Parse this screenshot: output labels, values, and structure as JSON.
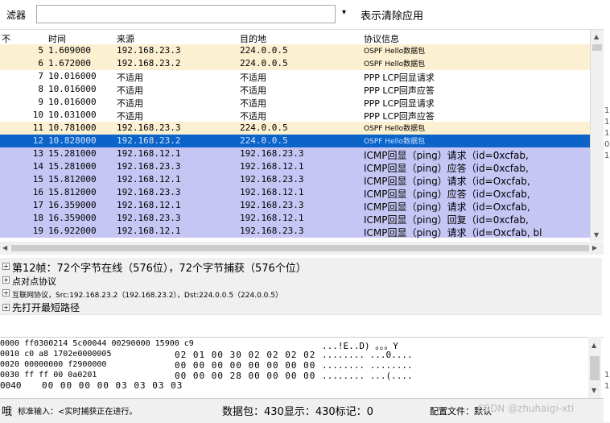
{
  "filter": {
    "label": "滤器",
    "value": "",
    "dropdown": "▾",
    "actions": "表示清除应用"
  },
  "columns": {
    "no": "不",
    "time": "时间",
    "source": "来源",
    "destination": "目的地",
    "info": "协议信息"
  },
  "packets": [
    {
      "no": "5",
      "time": "1.609000",
      "src": "192.168.23.3",
      "dst": "224.0.0.5",
      "info": "OSPF Hello数据包",
      "type": "ospf"
    },
    {
      "no": "6",
      "time": "1.672000",
      "src": "192.168.23.2",
      "dst": "224.0.0.5",
      "info": "OSPF Hello数据包",
      "type": "ospf"
    },
    {
      "no": "7",
      "time": "10.016000",
      "src": "不适用",
      "dst": "不适用",
      "info": "PPP LCP回显请求",
      "type": "ppp"
    },
    {
      "no": "8",
      "time": "10.016000",
      "src": "不适用",
      "dst": "不适用",
      "info": "PPP LCP回声应答",
      "type": "ppp"
    },
    {
      "no": "9",
      "time": "10.016000",
      "src": "不适用",
      "dst": "不适用",
      "info": "PPP LCP回显请求",
      "type": "ppp"
    },
    {
      "no": "10",
      "time": "10.031000",
      "src": "不适用",
      "dst": "不适用",
      "info": "PPP LCP回声应答",
      "type": "ppp"
    },
    {
      "no": "11",
      "time": "10.781000",
      "src": "192.168.23.3",
      "dst": "224.0.0.5",
      "info": "OSPF Hello数据包",
      "type": "ospf"
    },
    {
      "no": "12",
      "time": "10.828000",
      "src": "192.168.23.2",
      "dst": "224.0.0.5",
      "info": "OSPF Hello数据包",
      "type": "sel"
    },
    {
      "no": "13",
      "time": "15.281000",
      "src": "192.168.12.1",
      "dst": "192.168.23.3",
      "info": "ICMP回显（ping）请求（id=0xcfab,",
      "type": "icmp"
    },
    {
      "no": "14",
      "time": "15.281000",
      "src": "192.168.23.3",
      "dst": "192.168.12.1",
      "info": "ICMP回显（ping）应答（id=0xcfab,",
      "type": "icmp"
    },
    {
      "no": "15",
      "time": "15.812000",
      "src": "192.168.12.1",
      "dst": "192.168.23.3",
      "info": "ICMP回显（ping）请求（id=Oxcfab,",
      "type": "icmp"
    },
    {
      "no": "16",
      "time": "15.812000",
      "src": "192.168.23.3",
      "dst": "192.168.12.1",
      "info": "ICMP回显（ping）应答（id=Oxcfab,",
      "type": "icmp"
    },
    {
      "no": "17",
      "time": "16.359000",
      "src": "192.168.12.1",
      "dst": "192.168.23.3",
      "info": "ICMP回显（ping）请求（id=Oxcfab,",
      "type": "icmp"
    },
    {
      "no": "18",
      "time": "16.359000",
      "src": "192.168.23.3",
      "dst": "192.168.12.1",
      "info": "ICMP回显（ping）回复（id=0xcfab,",
      "type": "icmp"
    },
    {
      "no": "19",
      "time": "16.922000",
      "src": "192.168.12.1",
      "dst": "192.168.23.3",
      "info": "ICMP回显（ping）请求（id=Oxcfab, bl",
      "type": "icmp"
    }
  ],
  "right_edge_digits": [
    "1",
    "1",
    "1",
    "0",
    "1",
    "1",
    "1"
  ],
  "details": [
    {
      "text": "第12帧：72个字节在线（576位），72个字节捕获（576个位）"
    },
    {
      "text": "点对点协议"
    },
    {
      "text": "互联网协议，Src:192.168.23.2（192.168.23.2），Dst:224.0.0.5（224.0.0.5）"
    },
    {
      "text": "先打开最短路径"
    }
  ],
  "bytes": {
    "offsets": [
      "0000 ff0300214 5c00044 00290000 15900 c9",
      "0010 c0 a8 1702e0000005",
      "0020 00000000 f2900000",
      "0030 ff ff 00 0a0201",
      "0040"
    ],
    "hex": [
      "02 01 00 30 02 02 02 02",
      "00 00 00 00 00 00 00 00",
      "00 00 00 28 00 00 00 00"
    ],
    "hex_row5": "00 00 00 00 03 03 03 03",
    "ascii": [
      "...!E..D) 。。。Y",
      "........ ...0....",
      "........ ........",
      "........ ...(...."
    ]
  },
  "status": {
    "left_icon_char": "哦",
    "capture": "标准输入：<实时捕获正在进行。",
    "counts": "数据包：430显示：430标记：0",
    "profile": "配置文件：默认",
    "watermark": "CSDN @zhuhaigi-xti"
  },
  "colors": {
    "ospf": "#fbf0d2",
    "icmp": "#c6c6f5",
    "selected": "#0c64c8"
  }
}
